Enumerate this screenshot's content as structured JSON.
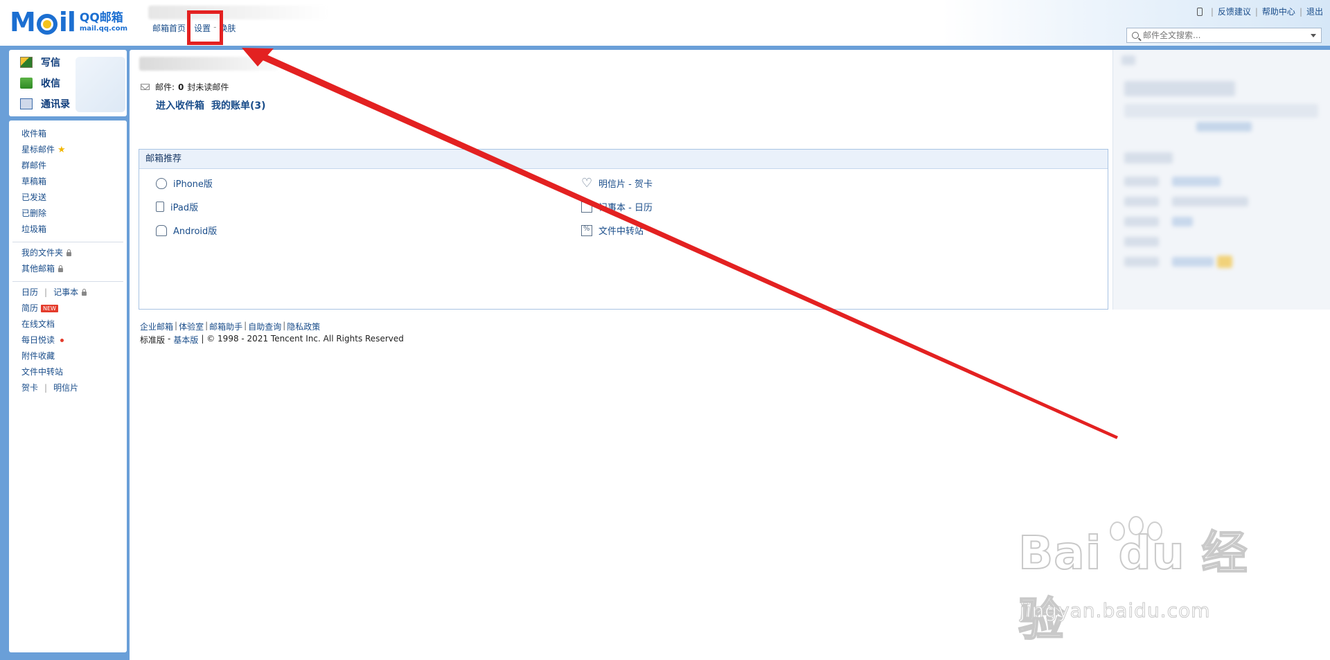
{
  "header": {
    "logo": {
      "word": "Mail",
      "brand_cn": "QQ邮箱",
      "url": "mail.qq.com"
    },
    "nav": {
      "home": "邮箱首页",
      "settings": "设置",
      "sep": "-",
      "skin": "换肤"
    },
    "top_links": {
      "feedback": "反馈建议",
      "help": "帮助中心",
      "logout": "退出",
      "sep": "|"
    },
    "search": {
      "placeholder": "邮件全文搜索..."
    }
  },
  "sidebar": {
    "actions": {
      "compose": "写信",
      "receive": "收信",
      "contacts": "通讯录"
    },
    "folders": {
      "inbox": "收件箱",
      "starred": "星标邮件",
      "group": "群邮件",
      "drafts": "草稿箱",
      "sent": "已发送",
      "deleted": "已删除",
      "spam": "垃圾箱"
    },
    "my_folders": "我的文件夹",
    "other_mailboxes": "其他邮箱",
    "calendar": "日历",
    "sep": "|",
    "notebook": "记事本",
    "resume": "简历",
    "new_badge": "NEW",
    "docs": "在线文档",
    "daily_reading": "每日悦读",
    "attachments": "附件收藏",
    "file_transfer": "文件中转站",
    "greeting_card": "贺卡",
    "postcard": "明信片"
  },
  "main": {
    "mail_label": "邮件:",
    "unread_count": "0",
    "unread_suffix": "封未读邮件",
    "enter_inbox": "进入收件箱",
    "my_bill": "我的账单(3)",
    "recommend": {
      "title": "邮箱推荐",
      "items": [
        {
          "label": "iPhone版",
          "icon": "apple-icon"
        },
        {
          "label": "iPad版",
          "icon": "ipad-icon"
        },
        {
          "label": "Android版",
          "icon": "android-icon"
        },
        {
          "label": "明信片 - 贺卡",
          "icon": "heart-icon"
        },
        {
          "label": "记事本 - 日历",
          "icon": "notebook-icon"
        },
        {
          "label": "文件中转站",
          "icon": "file-transfer-icon"
        }
      ]
    },
    "footer": {
      "links": [
        "企业邮箱",
        "体验室",
        "邮箱助手",
        "自助查询",
        "隐私政策"
      ],
      "link_sep": "|",
      "version_standard": "标准版",
      "version_dash": "-",
      "version_basic": "基本版",
      "copyright": "| © 1998 - 2021 Tencent Inc. All Rights Reserved"
    }
  },
  "annotation": {
    "box_color": "#e32121",
    "arrow_color": "#e32121"
  },
  "watermark": {
    "brand": "Bai du 经验",
    "url": "jingyan.baidu.com"
  },
  "colors": {
    "frame_blue": "#6a9fd8",
    "link": "#1a4d8a",
    "brand_blue": "#1c6fd1"
  }
}
